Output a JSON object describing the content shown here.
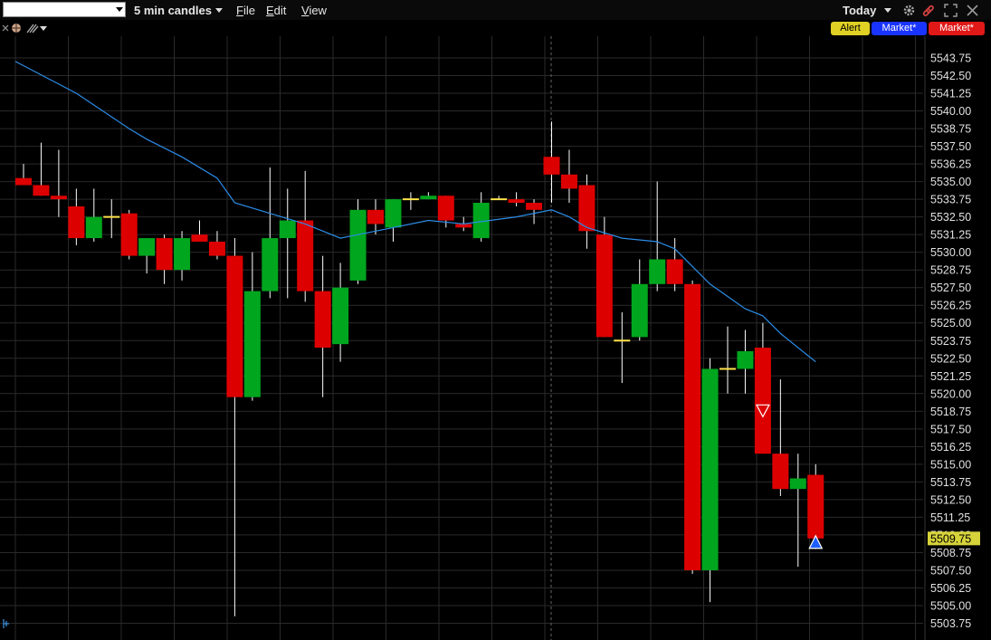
{
  "toolbar": {
    "symbol_value": "",
    "interval_label": "5 min candles",
    "menu": [
      "File",
      "Edit",
      "View"
    ],
    "range_label": "Today"
  },
  "buttons": {
    "alert": "Alert",
    "market_buy": "Market*",
    "market_sell": "Market*"
  },
  "colors": {
    "up": "#00a61e",
    "down": "#dd0000",
    "doji": "#ffe24a",
    "ma": "#2b8ce6",
    "grid": "#2a2a2a",
    "last_price_bg": "#d6d23a"
  },
  "chart_data": {
    "type": "candlestick",
    "interval": "5 min",
    "ylim": [
      5502.5,
      5545.0
    ],
    "y_ticks": [
      "5543.75",
      "5542.50",
      "5541.25",
      "5540.00",
      "5538.75",
      "5537.50",
      "5536.25",
      "5535.00",
      "5533.75",
      "5532.50",
      "5531.25",
      "5530.00",
      "5528.75",
      "5527.50",
      "5526.25",
      "5525.00",
      "5523.75",
      "5522.50",
      "5521.25",
      "5520.00",
      "5518.75",
      "5517.50",
      "5516.25",
      "5515.00",
      "5513.75",
      "5512.50",
      "5511.25",
      "5510.00",
      "5508.75",
      "5507.50",
      "5506.25",
      "5505.00",
      "5503.75"
    ],
    "last_price": "5509.75",
    "candles": [
      {
        "o": 5535.25,
        "h": 5536.25,
        "l": 5534.75,
        "c": 5534.75
      },
      {
        "o": 5534.75,
        "h": 5537.75,
        "l": 5534.0,
        "c": 5534.0
      },
      {
        "o": 5534.0,
        "h": 5537.25,
        "l": 5532.5,
        "c": 5533.75
      },
      {
        "o": 5533.25,
        "h": 5534.5,
        "l": 5530.5,
        "c": 5531.0
      },
      {
        "o": 5531.0,
        "h": 5534.5,
        "l": 5530.75,
        "c": 5532.5
      },
      {
        "o": 5532.5,
        "h": 5533.75,
        "l": 5531.0,
        "c": 5532.5
      },
      {
        "o": 5532.75,
        "h": 5533.0,
        "l": 5529.5,
        "c": 5529.75
      },
      {
        "o": 5529.75,
        "h": 5531.0,
        "l": 5528.5,
        "c": 5531.0
      },
      {
        "o": 5531.0,
        "h": 5531.25,
        "l": 5527.75,
        "c": 5528.75
      },
      {
        "o": 5528.75,
        "h": 5531.5,
        "l": 5528.0,
        "c": 5531.0
      },
      {
        "o": 5531.25,
        "h": 5532.25,
        "l": 5530.75,
        "c": 5530.75
      },
      {
        "o": 5530.75,
        "h": 5531.5,
        "l": 5529.5,
        "c": 5529.75
      },
      {
        "o": 5529.75,
        "h": 5531.0,
        "l": 5504.25,
        "c": 5519.75
      },
      {
        "o": 5519.75,
        "h": 5530.0,
        "l": 5519.5,
        "c": 5527.25
      },
      {
        "o": 5527.25,
        "h": 5536.0,
        "l": 5526.75,
        "c": 5531.0
      },
      {
        "o": 5531.0,
        "h": 5534.5,
        "l": 5526.75,
        "c": 5532.25
      },
      {
        "o": 5532.25,
        "h": 5535.75,
        "l": 5526.5,
        "c": 5527.25
      },
      {
        "o": 5527.25,
        "h": 5529.75,
        "l": 5519.75,
        "c": 5523.25
      },
      {
        "o": 5523.5,
        "h": 5529.25,
        "l": 5522.25,
        "c": 5527.5
      },
      {
        "o": 5528.0,
        "h": 5533.75,
        "l": 5527.75,
        "c": 5533.0
      },
      {
        "o": 5533.0,
        "h": 5533.75,
        "l": 5531.25,
        "c": 5532.0
      },
      {
        "o": 5531.75,
        "h": 5533.75,
        "l": 5530.75,
        "c": 5533.75
      },
      {
        "o": 5533.75,
        "h": 5534.25,
        "l": 5533.0,
        "c": 5533.75
      },
      {
        "o": 5533.75,
        "h": 5534.25,
        "l": 5533.75,
        "c": 5534.0
      },
      {
        "o": 5534.0,
        "h": 5534.0,
        "l": 5531.75,
        "c": 5532.25
      },
      {
        "o": 5532.0,
        "h": 5532.5,
        "l": 5531.5,
        "c": 5531.75
      },
      {
        "o": 5531.0,
        "h": 5534.25,
        "l": 5530.75,
        "c": 5533.5
      },
      {
        "o": 5533.75,
        "h": 5534.0,
        "l": 5533.75,
        "c": 5533.75
      },
      {
        "o": 5533.75,
        "h": 5534.25,
        "l": 5533.25,
        "c": 5533.5
      },
      {
        "o": 5533.5,
        "h": 5533.75,
        "l": 5532.0,
        "c": 5533.0
      },
      {
        "o": 5536.75,
        "h": 5539.25,
        "l": 5533.5,
        "c": 5535.5
      },
      {
        "o": 5535.5,
        "h": 5537.25,
        "l": 5533.5,
        "c": 5534.5
      },
      {
        "o": 5534.75,
        "h": 5535.5,
        "l": 5530.25,
        "c": 5531.5
      },
      {
        "o": 5531.25,
        "h": 5532.5,
        "l": 5524.0,
        "c": 5524.0
      },
      {
        "o": 5523.75,
        "h": 5525.75,
        "l": 5520.75,
        "c": 5523.75
      },
      {
        "o": 5524.0,
        "h": 5529.5,
        "l": 5523.75,
        "c": 5527.75
      },
      {
        "o": 5527.75,
        "h": 5535.0,
        "l": 5527.25,
        "c": 5529.5
      },
      {
        "o": 5529.5,
        "h": 5531.0,
        "l": 5527.25,
        "c": 5527.75
      },
      {
        "o": 5527.75,
        "h": 5528.0,
        "l": 5507.25,
        "c": 5507.5
      },
      {
        "o": 5507.5,
        "h": 5522.5,
        "l": 5505.25,
        "c": 5521.75
      },
      {
        "o": 5521.75,
        "h": 5524.75,
        "l": 5520.0,
        "c": 5521.75
      },
      {
        "o": 5521.75,
        "h": 5524.5,
        "l": 5520.0,
        "c": 5523.0
      },
      {
        "o": 5523.25,
        "h": 5525.0,
        "l": 5515.75,
        "c": 5515.75
      },
      {
        "o": 5515.75,
        "h": 5521.0,
        "l": 5512.75,
        "c": 5513.25
      },
      {
        "o": 5513.25,
        "h": 5515.75,
        "l": 5507.75,
        "c": 5514.0
      },
      {
        "o": 5514.25,
        "h": 5515.0,
        "l": 5509.0,
        "c": 5509.75
      }
    ],
    "moving_average": [
      {
        "i": 0,
        "v": 5543.5
      },
      {
        "i": 3,
        "v": 5541.25
      },
      {
        "i": 6,
        "v": 5538.75
      },
      {
        "i": 7,
        "v": 5538.0
      },
      {
        "i": 9,
        "v": 5536.75
      },
      {
        "i": 11,
        "v": 5535.25
      },
      {
        "i": 12,
        "v": 5533.5
      },
      {
        "i": 14,
        "v": 5532.75
      },
      {
        "i": 16,
        "v": 5532.0
      },
      {
        "i": 18,
        "v": 5531.0
      },
      {
        "i": 20,
        "v": 5531.5
      },
      {
        "i": 23,
        "v": 5532.25
      },
      {
        "i": 25,
        "v": 5532.0
      },
      {
        "i": 28,
        "v": 5532.5
      },
      {
        "i": 30,
        "v": 5533.0
      },
      {
        "i": 31,
        "v": 5532.5
      },
      {
        "i": 32,
        "v": 5531.75
      },
      {
        "i": 34,
        "v": 5531.0
      },
      {
        "i": 36,
        "v": 5530.75
      },
      {
        "i": 37,
        "v": 5530.25
      },
      {
        "i": 39,
        "v": 5527.75
      },
      {
        "i": 41,
        "v": 5526.0
      },
      {
        "i": 42,
        "v": 5525.5
      },
      {
        "i": 43,
        "v": 5524.25
      },
      {
        "i": 45,
        "v": 5522.25
      }
    ],
    "markers": [
      {
        "type": "sell",
        "i": 42,
        "y": 5518.75
      },
      {
        "type": "buy",
        "i": 45,
        "y": 5509.5
      }
    ]
  }
}
